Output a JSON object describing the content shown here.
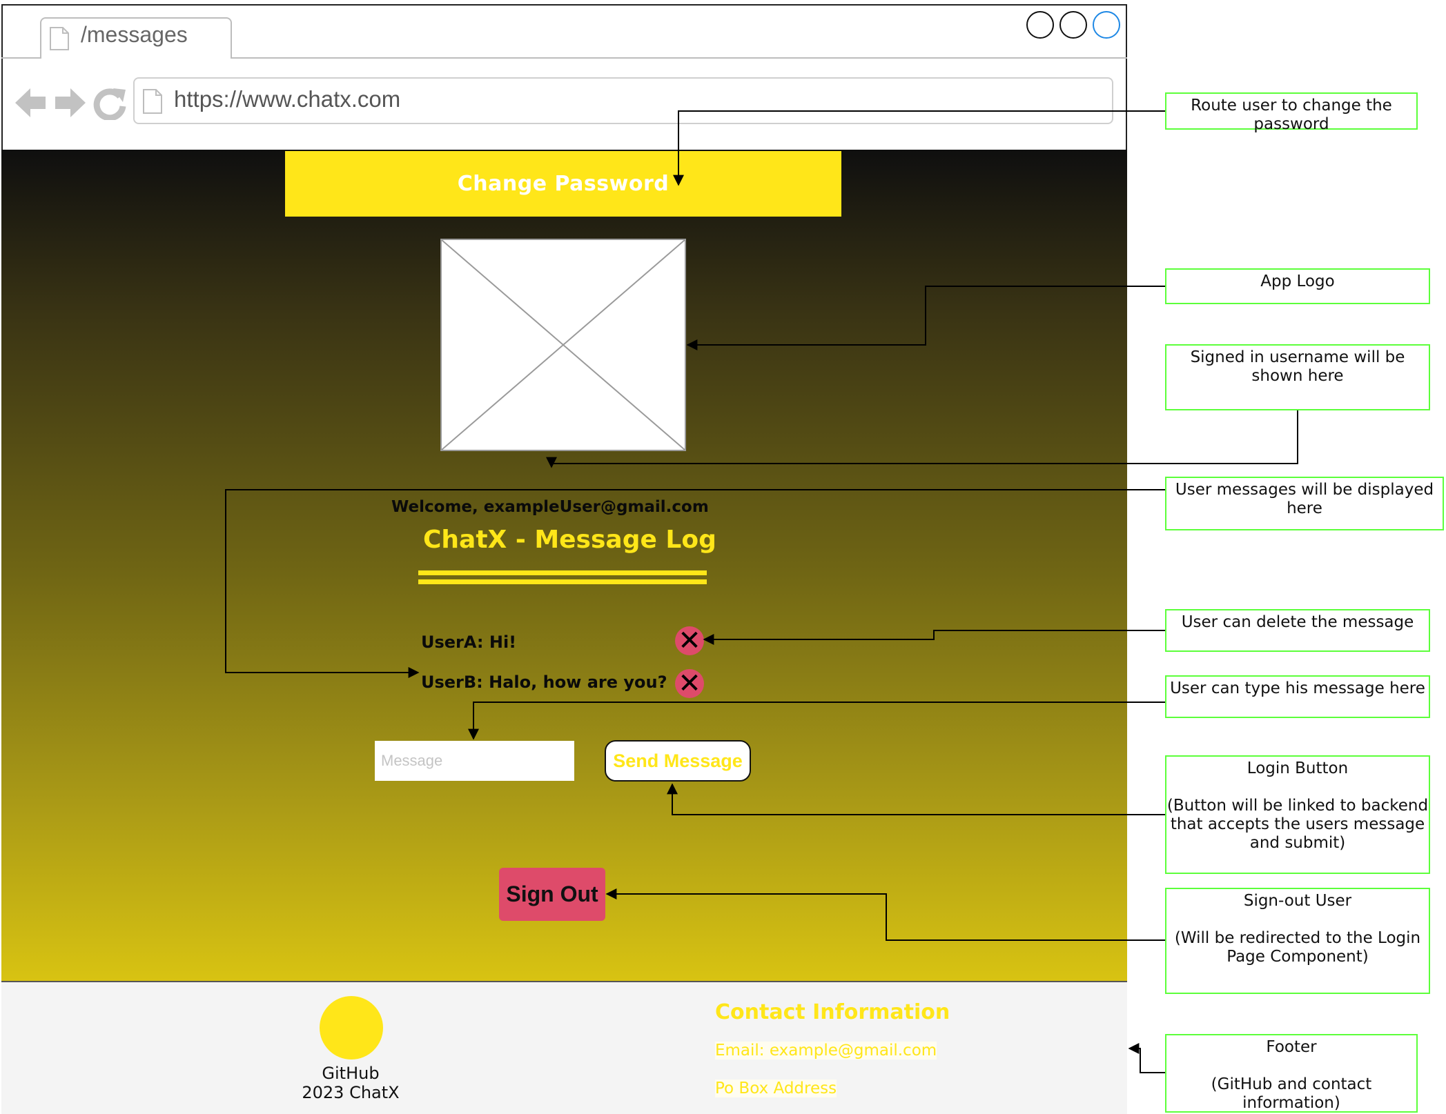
{
  "browser": {
    "tab_label": "/messages",
    "url": "https://www.chatx.com",
    "icons": [
      "back-arrow-icon",
      "forward-arrow-icon",
      "refresh-icon",
      "document-icon"
    ]
  },
  "app": {
    "change_password_label": "Change Password",
    "welcome_text": "Welcome, exampleUser@gmail.com",
    "log_title": "ChatX - Message Log",
    "messages": [
      {
        "text": "UserA: Hi!"
      },
      {
        "text": "UserB: Halo, how are you?"
      }
    ],
    "message_placeholder": "Message",
    "send_label": "Send Message",
    "signout_label": "Sign Out"
  },
  "footer": {
    "github_label": "GitHub",
    "copyright": "2023 ChatX",
    "contact_title": "Contact Information",
    "email": "Email: example@gmail.com",
    "address": "Po Box Address"
  },
  "annotations": {
    "change_password": "Route user to change the password",
    "logo": "App Logo",
    "username": "Signed in username will be shown here",
    "messages": "User messages will be displayed here",
    "delete": "User can delete the message",
    "type": "User can type his message here",
    "login_button": "Login Button\n\n(Button will be linked to backend that accepts the users message and submit)",
    "signout": "Sign-out User\n\n(Will be redirected to the Login Page Component)",
    "footer": "Footer\n\n(GitHub and contact information)"
  },
  "colors": {
    "accent_yellow": "#ffe619",
    "danger_pink": "#de4b6a",
    "annotation_border": "#5cff3a"
  }
}
